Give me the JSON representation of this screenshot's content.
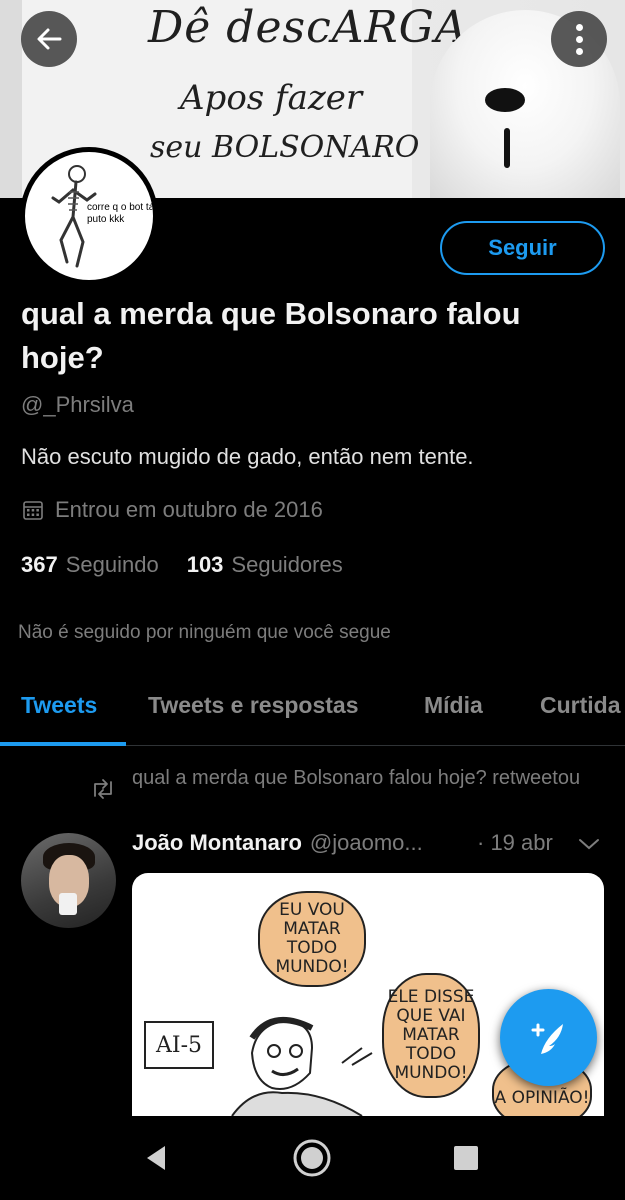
{
  "banner": {
    "line1": "Dê descARGA",
    "line2": "Apos fazer",
    "line3": "seu BOLSONARO"
  },
  "header_buttons": {
    "back_icon": "arrow-left-icon",
    "more_icon": "more-vertical-icon"
  },
  "profile": {
    "avatar_caption": "corre q o bot tá puto kkk",
    "follow_label": "Seguir",
    "name": "qual a merda que Bolsonaro falou hoje?",
    "handle": "@_Phrsilva",
    "bio": "Não escuto mugido de gado, então nem tente.",
    "joined": "Entrou em outubro de 2016",
    "following_count": "367",
    "following_label": "Seguindo",
    "followers_count": "103",
    "followers_label": "Seguidores",
    "not_followed": "Não é seguido por ninguém que você segue"
  },
  "tabs": [
    {
      "label": "Tweets",
      "active": true
    },
    {
      "label": "Tweets e respostas",
      "active": false
    },
    {
      "label": "Mídia",
      "active": false
    },
    {
      "label": "Curtida",
      "active": false
    }
  ],
  "tweet": {
    "retweet_text": "qual a merda que Bolsonaro falou hoje? retweetou",
    "author_name": "João Montanaro",
    "author_handle": "@joaomo...",
    "time": "· 19 abr",
    "media": {
      "bubble1": "EU VOU MATAR TODO MUNDO!",
      "bubble2": "ELE DISSE QUE VAI MATAR TODO MUNDO!",
      "bubble3": "A OPINIÃO!",
      "sign": "AI-5"
    }
  },
  "colors": {
    "accent": "#1d9bf0",
    "background": "#000000",
    "muted_text": "#7d7d7d"
  }
}
